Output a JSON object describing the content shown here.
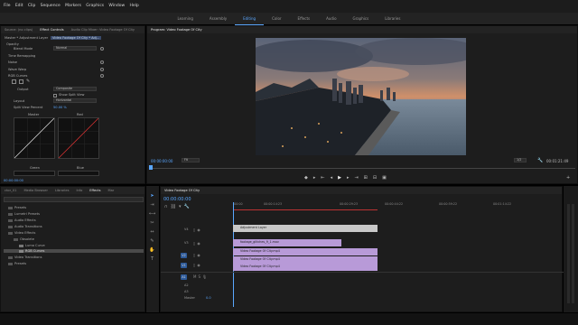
{
  "menu": [
    "File",
    "Edit",
    "Clip",
    "Sequence",
    "Markers",
    "Graphics",
    "Window",
    "Help"
  ],
  "workspaces": {
    "items": [
      "Learning",
      "Assembly",
      "Editing",
      "Color",
      "Effects",
      "Audio",
      "Graphics",
      "Libraries"
    ],
    "active": "Editing"
  },
  "effect_controls": {
    "tabs": [
      "Source: (no clips)",
      "Effect Controls",
      "Audio Clip Mixer: Video Footage Of City",
      "Metadata"
    ],
    "active_tab": "Effect Controls",
    "master_clip": "Master * Adjustment Layer",
    "sequence_clip": "Video Footage Of City * Adj...",
    "rows": {
      "opacity": "Opacity",
      "blend_mode_label": "Blend Mode",
      "blend_mode_value": "Normal",
      "time_remapping": "Time Remapping",
      "noise": "Noise",
      "wave_warp": "Wave Warp",
      "rgb_curves": "RGB Curves",
      "output_label": "Output",
      "output_value": "Composite",
      "show_split_view": "Show Split View",
      "layout_label": "Layout",
      "layout_value": "Horizontal",
      "split_view_label": "Split View Percent",
      "split_view_value": "50.00 %",
      "master_label": "Master",
      "red_label": "Red",
      "green_label": "Green",
      "blue_label": "Blue"
    },
    "timecode": "00:00:00:00"
  },
  "program": {
    "title": "Program: Video Footage Of City",
    "timecode_left": "00:00:00:00",
    "fit": "Fit",
    "resolution": "1/2",
    "timecode_right": "00:01:21:49"
  },
  "project": {
    "tabs": [
      "ctor_01",
      "Media Browser",
      "Libraries",
      "Info",
      "Effects",
      "Mar"
    ],
    "active_tab": "Effects",
    "items": [
      {
        "label": "Presets",
        "level": 0
      },
      {
        "label": "Lumetri Presets",
        "level": 0
      },
      {
        "label": "Audio Effects",
        "level": 0
      },
      {
        "label": "Audio Transitions",
        "level": 0
      },
      {
        "label": "Video Effects",
        "level": 0
      },
      {
        "label": "Obsolete",
        "level": 1
      },
      {
        "label": "Luma Curve",
        "level": 2
      },
      {
        "label": "RGB Curves",
        "level": 2,
        "selected": true
      },
      {
        "label": "Video Transitions",
        "level": 0
      },
      {
        "label": "Presets",
        "level": 0
      }
    ]
  },
  "timeline": {
    "title": "Video Footage Of City",
    "timecode": "00:00:00:00",
    "ruler": [
      ":00:00",
      "00:00:14:23",
      "00:00:29:23",
      "00:00:44:22",
      "00:00:59:22",
      "00:01:14:22"
    ],
    "video_tracks": [
      "V4",
      "V3",
      "V2",
      "V1"
    ],
    "audio_tracks": [
      "A1",
      "A2",
      "A3"
    ],
    "master_label": "Master",
    "master_value": "0.0",
    "clips": {
      "adjustment": "Adjustment Layer",
      "v3": "footage_glitches_9_1.mov",
      "v2": "Video Footage Of City.mp4",
      "v1": "Video Footage Of City.mp4",
      "a1": "Video Footage Of City.mp4"
    }
  }
}
